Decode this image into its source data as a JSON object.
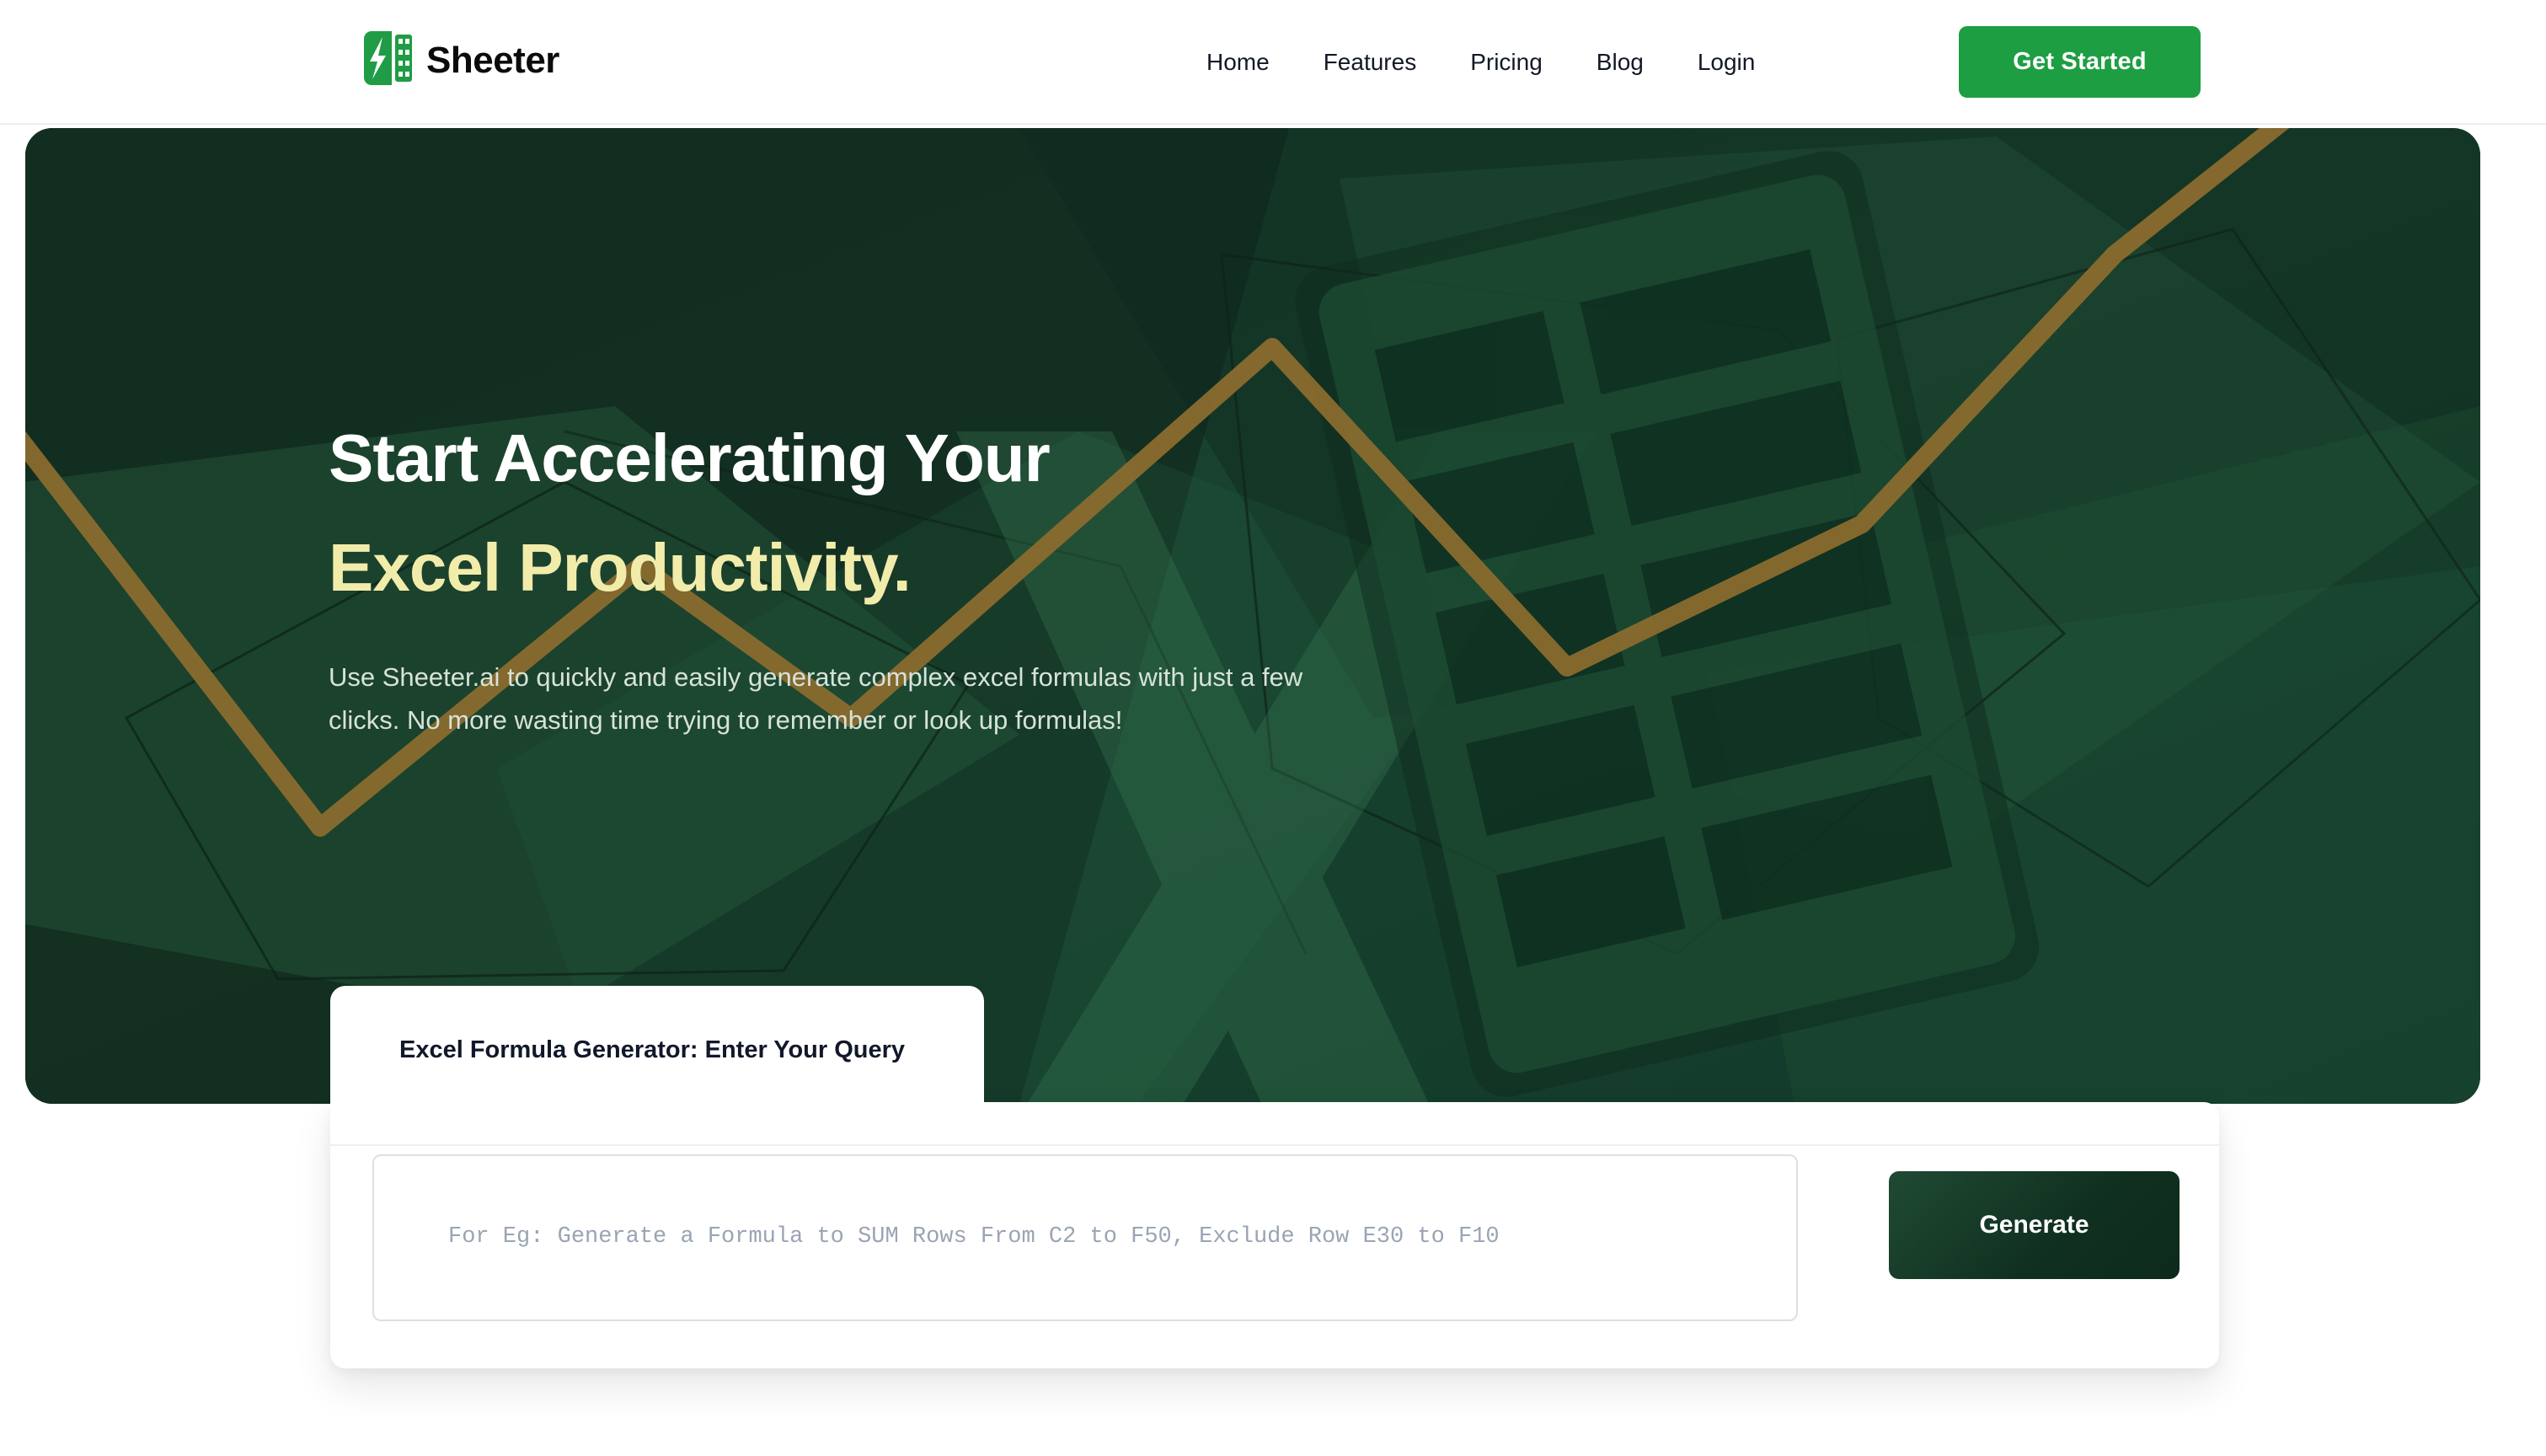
{
  "colors": {
    "brand_green": "#1E9E43",
    "hero_dark_green": "#173F2C",
    "hero_deep_green": "#112A1D",
    "accent_yellow": "#F2ECAB",
    "gold_line": "#8A6B2E",
    "white": "#FFFFFF",
    "body_text": "#D7E2DA",
    "placeholder": "#9AA4B4",
    "border": "#DCDFE4"
  },
  "header": {
    "logo": {
      "icon_name": "sheeter-logo-icon",
      "wordmark": "Sheeter"
    },
    "nav": [
      {
        "label": "Home"
      },
      {
        "label": "Features"
      },
      {
        "label": "Pricing"
      },
      {
        "label": "Blog"
      },
      {
        "label": "Login"
      }
    ],
    "cta": {
      "label": "Get Started"
    }
  },
  "hero": {
    "headline_line1": "Start Accelerating Your",
    "headline_line2": "Excel Productivity.",
    "subtext": "Use Sheeter.ai to quickly and easily generate complex excel formulas with just a few clicks. No more wasting time trying to remember or look up formulas!",
    "background_icon": "excel-x-watermark-icon"
  },
  "generator": {
    "tab_label": "Excel Formula Generator: Enter Your Query",
    "input": {
      "value": "",
      "placeholder": "For Eg: Generate a Formula to SUM Rows From C2 to F50, Exclude Row E30 to F10"
    },
    "submit": {
      "label": "Generate"
    }
  }
}
